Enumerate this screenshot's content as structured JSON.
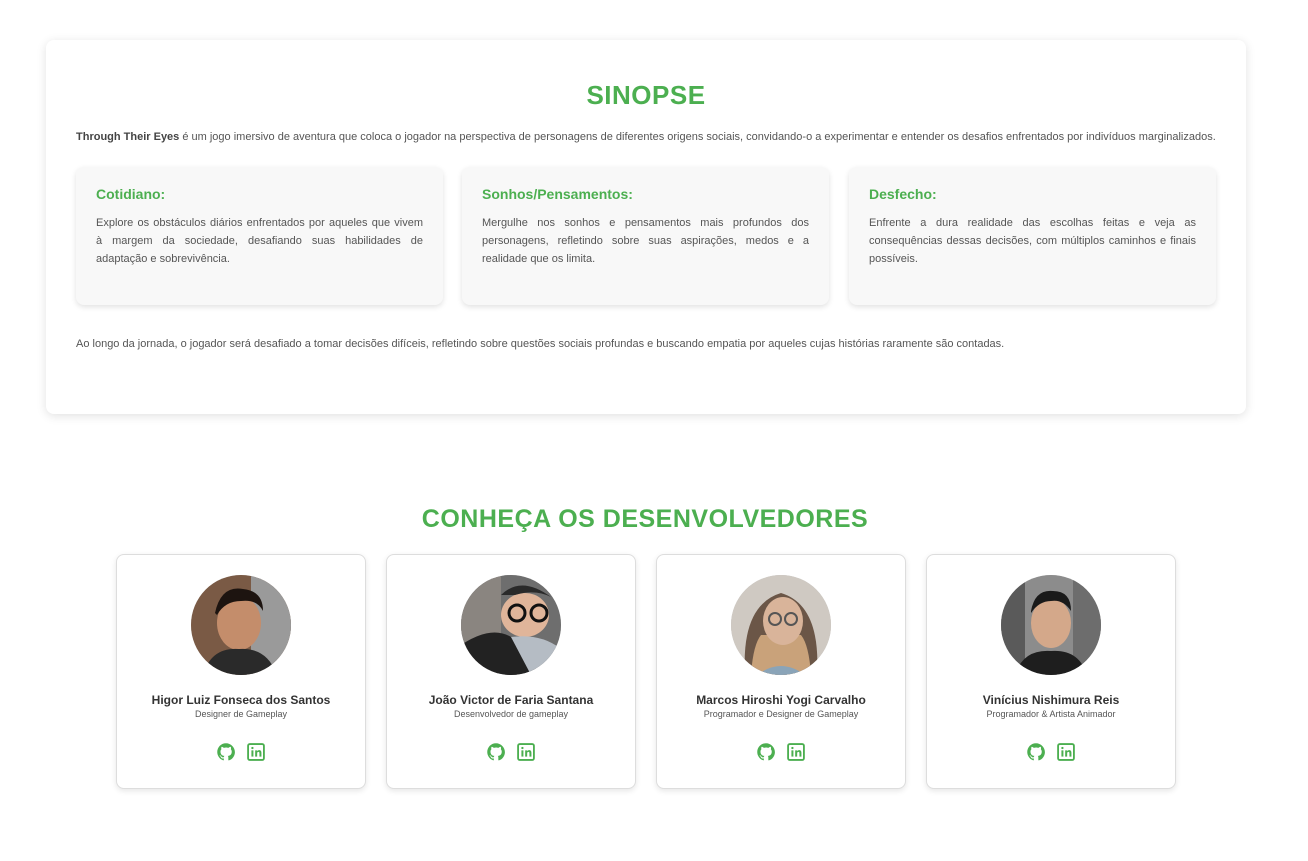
{
  "synopsis": {
    "title": "SINOPSE",
    "intro_game": "Through Their Eyes",
    "intro_text": " é um jogo imersivo de aventura que coloca o jogador na perspectiva de personagens de diferentes origens sociais, convidando-o a experimentar e entender os desafios enfrentados por indivíduos marginalizados.",
    "cards": [
      {
        "title": "Cotidiano:",
        "text": "Explore os obstáculos diários enfrentados por aqueles que vivem à margem da sociedade, desafiando suas habilidades de adaptação e sobrevivência."
      },
      {
        "title": "Sonhos/Pensamentos:",
        "text": "Mergulhe nos sonhos e pensamentos mais profundos dos personagens, refletindo sobre suas aspirações, medos e a realidade que os limita."
      },
      {
        "title": "Desfecho:",
        "text": "Enfrente a dura realidade das escolhas feitas e veja as consequências dessas decisões, com múltiplos caminhos e finais possíveis."
      }
    ],
    "outro": "Ao longo da jornada, o jogador será desafiado a tomar decisões difíceis, refletindo sobre questões sociais profundas e buscando empatia por aqueles cujas histórias raramente são contadas."
  },
  "developers": {
    "title": "CONHEÇA OS DESENVOLVEDORES",
    "accent_color": "#4caf50",
    "people": [
      {
        "name": "Higor Luiz Fonseca dos Santos",
        "role": "Designer de Gameplay",
        "icons": [
          "github-icon",
          "linkedin-icon"
        ]
      },
      {
        "name": "João Victor de Faria Santana",
        "role": "Desenvolvedor de gameplay",
        "icons": [
          "github-icon",
          "linkedin-icon"
        ]
      },
      {
        "name": "Marcos Hiroshi Yogi Carvalho",
        "role": "Programador e Designer de Gameplay",
        "icons": [
          "github-icon",
          "linkedin-icon"
        ]
      },
      {
        "name": "Vinícius Nishimura Reis",
        "role": "Programador & Artista Animador",
        "icons": [
          "github-icon",
          "linkedin-icon"
        ]
      }
    ]
  }
}
